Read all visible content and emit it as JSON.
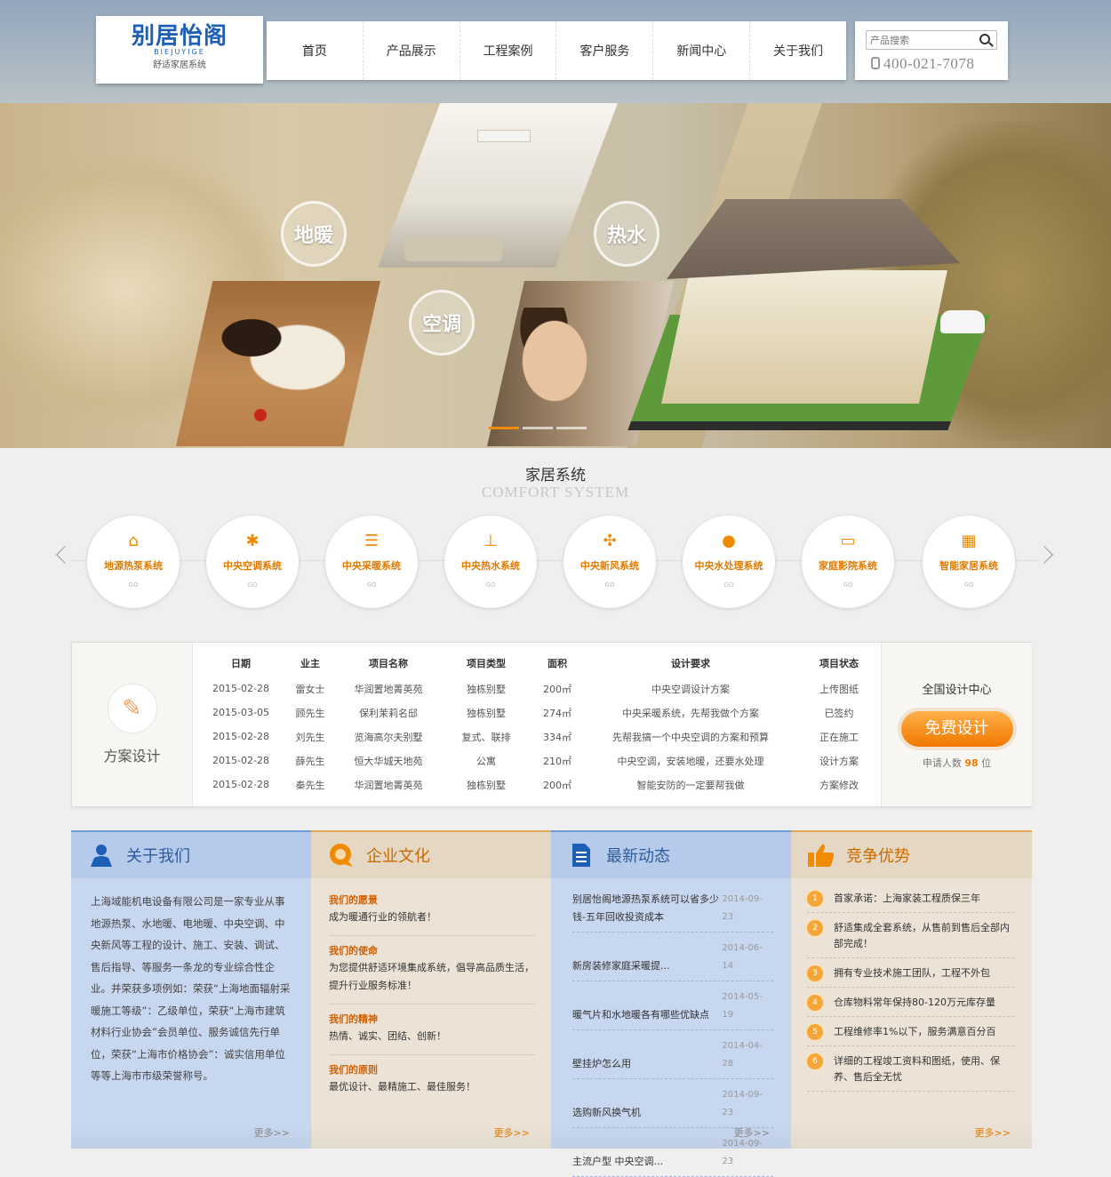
{
  "header": {
    "logo": {
      "main": "别居怡阁",
      "pinyin": "BIEJUYIGE",
      "sub": "舒适家居系统"
    },
    "nav": [
      {
        "label": "首页"
      },
      {
        "label": "产品展示"
      },
      {
        "label": "工程案例"
      },
      {
        "label": "客户服务"
      },
      {
        "label": "新闻中心"
      },
      {
        "label": "关于我们"
      }
    ],
    "search": {
      "placeholder": "产品搜索"
    },
    "phone": "400-021-7078"
  },
  "banner": {
    "badges": [
      "地暖",
      "空调",
      "热水"
    ],
    "slides": 3,
    "active_slide": 1
  },
  "systems": {
    "title": "家居系统",
    "subtitle": "COMFORT SYSTEM",
    "go_label": "GO",
    "items": [
      {
        "label": "地源热泵系统",
        "icon": "house-icon"
      },
      {
        "label": "中央空调系统",
        "icon": "snowflake-icon"
      },
      {
        "label": "中央采暖系统",
        "icon": "radiator-icon"
      },
      {
        "label": "中央热水系统",
        "icon": "shower-icon"
      },
      {
        "label": "中央新风系统",
        "icon": "fan-icon"
      },
      {
        "label": "中央水处理系统",
        "icon": "water-drop-icon"
      },
      {
        "label": "家庭影院系统",
        "icon": "monitor-icon"
      },
      {
        "label": "智能家居系统",
        "icon": "control-panel-icon"
      }
    ]
  },
  "design": {
    "left_title": "方案设计",
    "columns": [
      "日期",
      "业主",
      "项目名称",
      "项目类型",
      "面积",
      "设计要求",
      "项目状态"
    ],
    "rows": [
      [
        "2015-02-28",
        "雷女士",
        "华润置地菁英苑",
        "独栋别墅",
        "200㎡",
        "中央空调设计方案",
        "上传图纸"
      ],
      [
        "2015-03-05",
        "顾先生",
        "保利茉莉名邸",
        "独栋别墅",
        "274㎡",
        "中央采暖系统，先帮我做个方案",
        "已签约"
      ],
      [
        "2015-02-28",
        "刘先生",
        "览海高尔夫别墅",
        "复式、联排",
        "334㎡",
        "先帮我搞一个中央空调的方案和预算",
        "正在施工"
      ],
      [
        "2015-02-28",
        "薛先生",
        "恒大华城天地苑",
        "公寓",
        "210㎡",
        "中央空调，安装地暖，还要水处理",
        "设计方案"
      ],
      [
        "2015-02-28",
        "秦先生",
        "华润置地菁英苑",
        "独栋别墅",
        "200㎡",
        "智能安防的一定要帮我做",
        "方案修改"
      ]
    ],
    "right_title": "全国设计中心",
    "button": "免费设计",
    "count_prefix": "申请人数",
    "count": "98",
    "count_suffix": "位"
  },
  "about": {
    "title": "关于我们",
    "text": "上海域能机电设备有限公司是一家专业从事地源热泵、水地暖、电地暖、中央空调、中央新风等工程的设计、施工、安装、调试、售后指导、等服务一条龙的专业综合性企业。并荣获多项例如：荣获“上海地面辐射采暖施工等级”：乙级单位，荣获“上海市建筑材料行业协会”会员单位、服务诚信先行单位，荣获“上海市价格协会”：诚实信用单位等等上海市市级荣誉称号。",
    "more": "更多>>"
  },
  "culture": {
    "title": "企业文化",
    "items": [
      {
        "k": "我们的愿景",
        "v": "成为暖通行业的领航者！"
      },
      {
        "k": "我们的使命",
        "v": "为您提供舒适环境集成系统，倡导高品质生活，提升行业服务标准！"
      },
      {
        "k": "我们的精神",
        "v": "热情、诚实、团结、创新！"
      },
      {
        "k": "我们的原则",
        "v": "最优设计、最精施工、最佳服务！"
      }
    ],
    "more": "更多>>"
  },
  "news": {
    "title": "最新动态",
    "items": [
      {
        "t": "别居怡阁地源热泵系统可以省多少钱-五年回收投资成本",
        "d": "2014-09-23"
      },
      {
        "t": "新房装修家庭采暖提...",
        "d": "2014-06-14"
      },
      {
        "t": "暖气片和水地暖各有哪些优缺点",
        "d": "2014-05-19"
      },
      {
        "t": "壁挂炉怎么用",
        "d": "2014-04-28"
      },
      {
        "t": "选购新风换气机",
        "d": "2014-09-23"
      },
      {
        "t": "主流户型 中央空调...",
        "d": "2014-09-23"
      }
    ],
    "more": "更多>>"
  },
  "advantage": {
    "title": "竞争优势",
    "items": [
      "首家承诺：上海家装工程质保三年",
      "舒适集成全套系统，从售前到售后全部内部完成！",
      "拥有专业技术施工团队，工程不外包",
      "仓库物料常年保持80-120万元库存量",
      "工程维修率1%以下，服务满意百分百",
      "详细的工程竣工资料和图纸，使用、保养、售后全无忧"
    ],
    "more": "更多>>"
  },
  "colors": {
    "accent": "#f08a00",
    "blue": "#2d5b9b"
  }
}
